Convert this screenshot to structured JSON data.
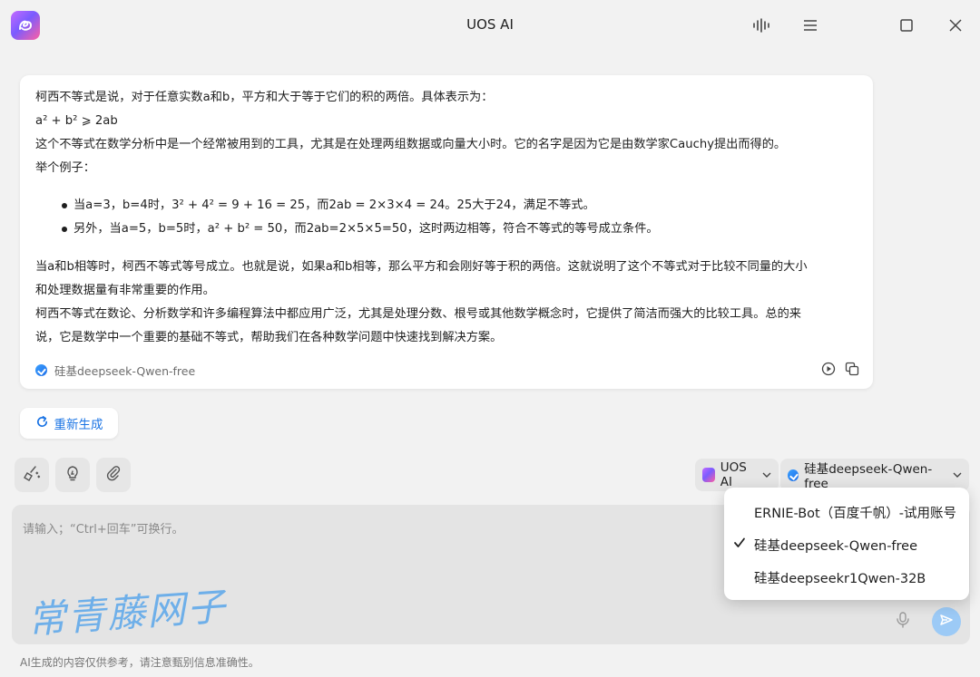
{
  "window": {
    "title": "UOS AI"
  },
  "response": {
    "lines": [
      "柯西不等式是说，对于任意实数a和b，平方和大于等于它们的积的两倍。具体表示为：",
      "a² + b² ⩾ 2ab",
      "这个不等式在数学分析中是一个经常被用到的工具，尤其是在处理两组数据或向量大小时。它的名字是因为它是由数学家Cauchy提出而得的。",
      "举个例子："
    ],
    "bullets": [
      "当a=3，b=4时，3² + 4² = 9 + 16 = 25，而2ab = 2×3×4 = 24。25大于24，满足不等式。",
      "另外，当a=5，b=5时，a² + b² = 50，而2ab=2×5×5=50，这时两边相等，符合不等式的等号成立条件。"
    ],
    "paragraph": [
      "当a和b相等时，柯西不等式等号成立。也就是说，如果a和b相等，那么平方和会刚好等于积的两倍。这就说明了这个不等式对于比较不同量的大小",
      "和处理数据量有非常重要的作用。",
      "柯西不等式在数论、分析数学和许多编程算法中都应用广泛，尤其是处理分数、根号或其他数学概念时，它提供了简洁而强大的比较工具。总的来",
      "说，它是数学中一个重要的基础不等式，帮助我们在各种数学问题中快速找到解决方案。"
    ],
    "model": "硅基deepseek-Qwen-free"
  },
  "regenerate_label": "重新生成",
  "selectors": {
    "assistant": "UOS AI",
    "model": "硅基deepseek-Qwen-free"
  },
  "input": {
    "placeholder": "请输入；“Ctrl+回车”可换行。",
    "value": ""
  },
  "dropdown": {
    "items": [
      {
        "label": "ERNIE-Bot（百度千帆）-试用账号",
        "selected": false
      },
      {
        "label": "硅基deepseek-Qwen-free",
        "selected": true
      },
      {
        "label": "硅基deepseekr1Qwen-32B",
        "selected": false
      }
    ]
  },
  "watermark": "常青藤网子",
  "footer": "AI生成的内容仅供参考，请注意甄别信息准确性。",
  "colors": {
    "accent": "#1b74e4",
    "send": "#9ccaf6",
    "logo": "#a064ff"
  }
}
